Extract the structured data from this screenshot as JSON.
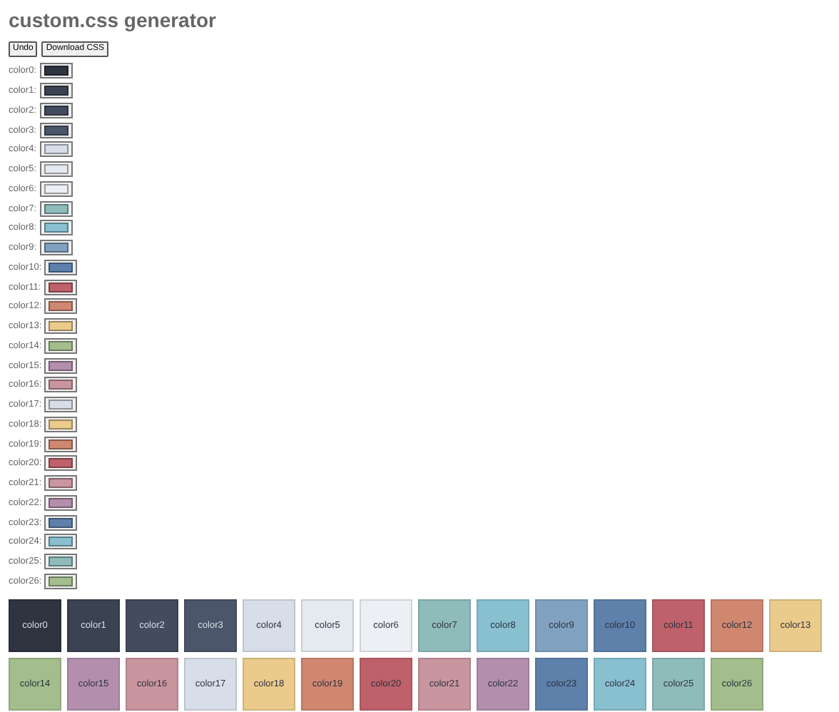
{
  "title": "custom.css generator",
  "buttons": [
    {
      "label": "Undo"
    },
    {
      "label": "Download CSS"
    }
  ],
  "pickers": [
    {
      "label": "color0:",
      "color": "#2e3440"
    },
    {
      "label": "color1:",
      "color": "#3b4252"
    },
    {
      "label": "color2:",
      "color": "#434c5e"
    },
    {
      "label": "color3:",
      "color": "#4c566a"
    },
    {
      "label": "color4:",
      "color": "#d8dee9"
    },
    {
      "label": "color5:",
      "color": "#e5e9f0"
    },
    {
      "label": "color6:",
      "color": "#eceff4"
    },
    {
      "label": "color7:",
      "color": "#8fbcbb"
    },
    {
      "label": "color8:",
      "color": "#88c0d0"
    },
    {
      "label": "color9:",
      "color": "#81a1c1"
    },
    {
      "label": "color10:",
      "color": "#5e81ac"
    },
    {
      "label": "color11:",
      "color": "#bf616a"
    },
    {
      "label": "color12:",
      "color": "#d08770"
    },
    {
      "label": "color13:",
      "color": "#ebcb8b"
    },
    {
      "label": "color14:",
      "color": "#a3be8c"
    },
    {
      "label": "color15:",
      "color": "#b48ead"
    },
    {
      "label": "color16:",
      "color": "#c9959f"
    },
    {
      "label": "color17:",
      "color": "#d8dee9"
    },
    {
      "label": "color18:",
      "color": "#ebcb8b"
    },
    {
      "label": "color19:",
      "color": "#d08770"
    },
    {
      "label": "color20:",
      "color": "#bf616a"
    },
    {
      "label": "color21:",
      "color": "#c9959f"
    },
    {
      "label": "color22:",
      "color": "#b48ead"
    },
    {
      "label": "color23:",
      "color": "#5e81ac"
    },
    {
      "label": "color24:",
      "color": "#88c0d0"
    },
    {
      "label": "color25:",
      "color": "#8fbcbb"
    },
    {
      "label": "color26:",
      "color": "#a3be8c"
    }
  ],
  "swatches": [
    {
      "label": "color0",
      "color": "#2e3440"
    },
    {
      "label": "color1",
      "color": "#3b4252"
    },
    {
      "label": "color2",
      "color": "#434c5e"
    },
    {
      "label": "color3",
      "color": "#4c566a"
    },
    {
      "label": "color4",
      "color": "#d8dee9"
    },
    {
      "label": "color5",
      "color": "#e5e9f0"
    },
    {
      "label": "color6",
      "color": "#eceff4"
    },
    {
      "label": "color7",
      "color": "#8fbcbb"
    },
    {
      "label": "color8",
      "color": "#88c0d0"
    },
    {
      "label": "color9",
      "color": "#81a1c1"
    },
    {
      "label": "color10",
      "color": "#5e81ac"
    },
    {
      "label": "color11",
      "color": "#bf616a"
    },
    {
      "label": "color12",
      "color": "#d08770"
    },
    {
      "label": "color13",
      "color": "#ebcb8b"
    },
    {
      "label": "color14",
      "color": "#a3be8c"
    },
    {
      "label": "color15",
      "color": "#b48ead"
    },
    {
      "label": "color16",
      "color": "#c9959f"
    },
    {
      "label": "color17",
      "color": "#d8dee9"
    },
    {
      "label": "color18",
      "color": "#ebcb8b"
    },
    {
      "label": "color19",
      "color": "#d08770"
    },
    {
      "label": "color20",
      "color": "#bf616a"
    },
    {
      "label": "color21",
      "color": "#c9959f"
    },
    {
      "label": "color22",
      "color": "#b48ead"
    },
    {
      "label": "color23",
      "color": "#5e81ac"
    },
    {
      "label": "color24",
      "color": "#88c0d0"
    },
    {
      "label": "color25",
      "color": "#8fbcbb"
    },
    {
      "label": "color26",
      "color": "#a3be8c"
    }
  ]
}
